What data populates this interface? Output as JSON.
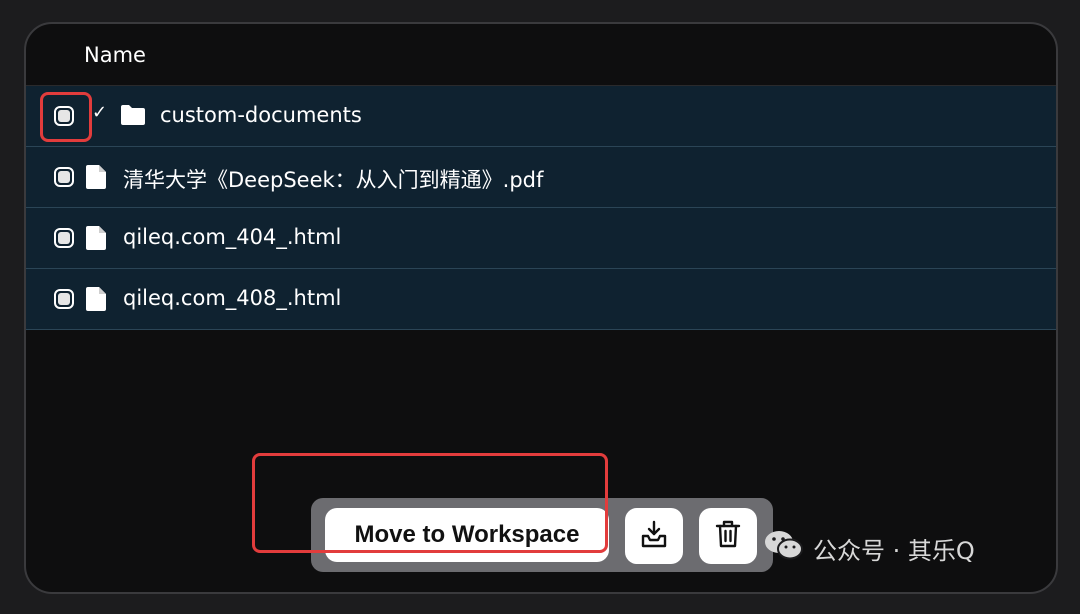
{
  "table": {
    "header": "Name",
    "rows": [
      {
        "type": "folder",
        "name": "custom-documents",
        "check": "✓"
      },
      {
        "type": "file",
        "name": "清华大学《DeepSeek：从入门到精通》.pdf"
      },
      {
        "type": "file",
        "name": "qileq.com_404_.html"
      },
      {
        "type": "file",
        "name": "qileq.com_408_.html"
      }
    ]
  },
  "toolbar": {
    "move_label": "Move to Workspace",
    "download_icon": "download-tray-icon",
    "delete_icon": "trash-icon"
  },
  "watermark": {
    "text": "公众号 · 其乐Q"
  },
  "colors": {
    "row_bg": "#0f2230",
    "highlight": "#e23c3c",
    "toolbar_bg": "#6c6c70"
  }
}
